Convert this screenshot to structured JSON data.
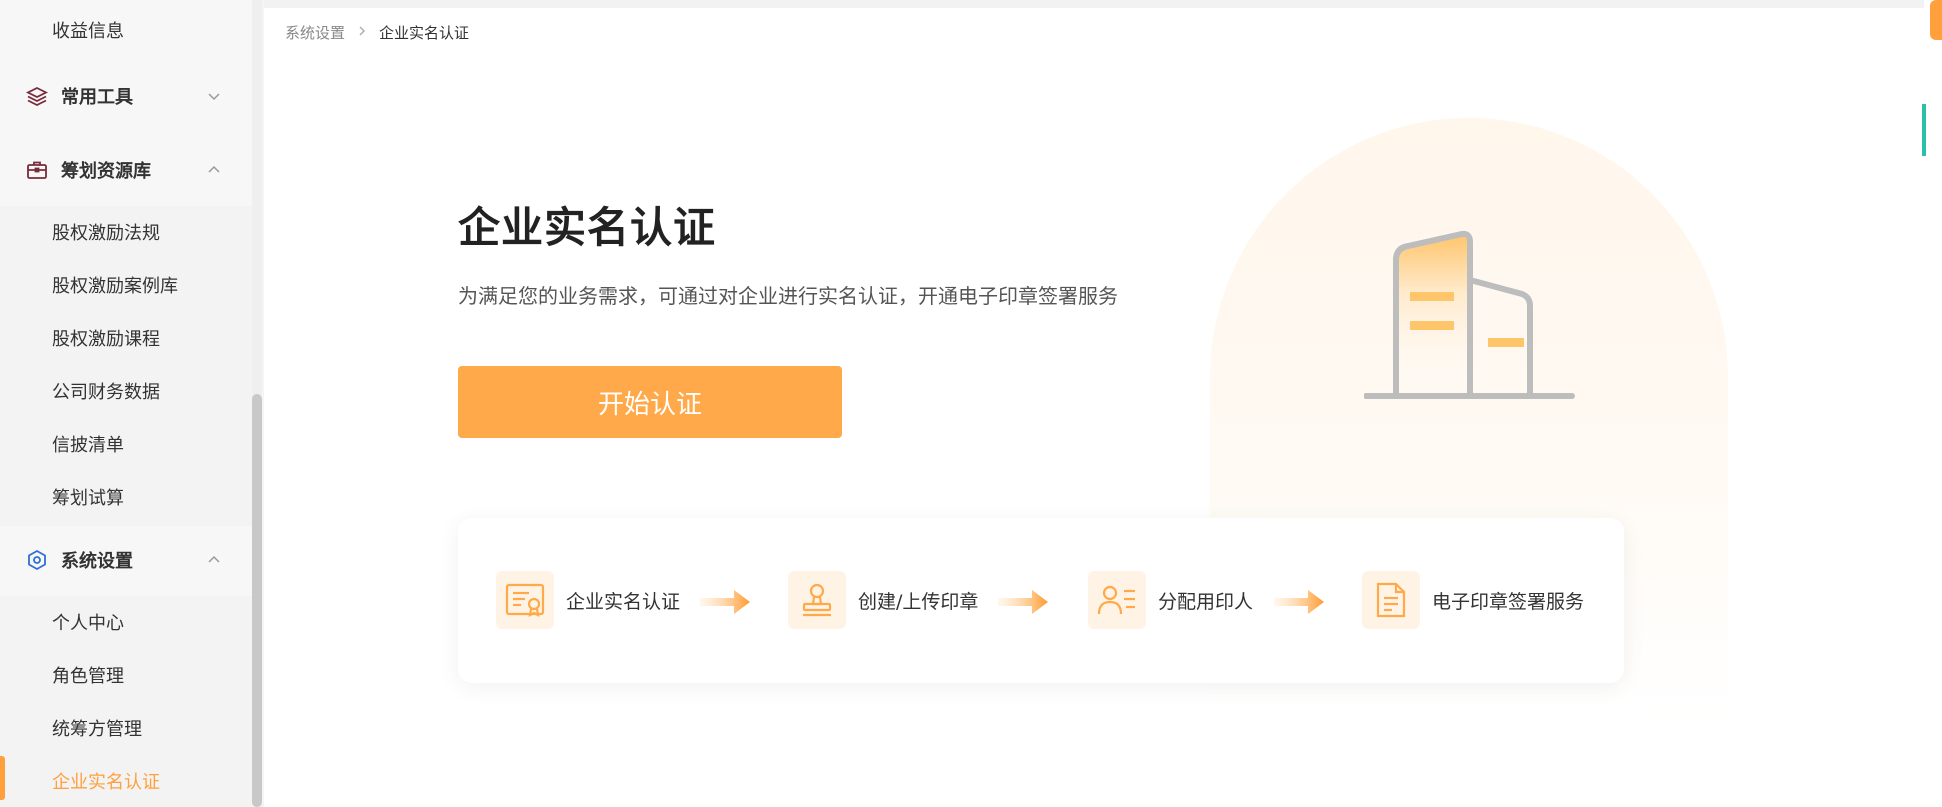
{
  "sidebar": {
    "items": [
      {
        "label": "收益信息"
      },
      {
        "label": "常用工具",
        "icon": "layers-icon"
      },
      {
        "label": "筹划资源库",
        "icon": "briefcase-icon"
      },
      {
        "label": "股权激励法规"
      },
      {
        "label": "股权激励案例库"
      },
      {
        "label": "股权激励课程"
      },
      {
        "label": "公司财务数据"
      },
      {
        "label": "信披清单"
      },
      {
        "label": "筹划试算"
      },
      {
        "label": "系统设置",
        "icon": "hexagon-gear-icon"
      },
      {
        "label": "个人中心"
      },
      {
        "label": "角色管理"
      },
      {
        "label": "统筹方管理"
      },
      {
        "label": "企业实名认证"
      }
    ]
  },
  "breadcrumb": {
    "parent": "系统设置",
    "current": "企业实名认证"
  },
  "hero": {
    "title": "企业实名认证",
    "description": "为满足您的业务需求，可通过对企业进行实名认证，开通电子印章签署服务",
    "button": "开始认证"
  },
  "steps": [
    {
      "label": "企业实名认证",
      "icon": "certificate-icon"
    },
    {
      "label": "创建/上传印章",
      "icon": "stamp-icon"
    },
    {
      "label": "分配用印人",
      "icon": "user-list-icon"
    },
    {
      "label": "电子印章签署服务",
      "icon": "document-icon"
    }
  ],
  "colors": {
    "accent": "#ffa03d",
    "button": "#ffa94a",
    "teal": "#2bc0a8"
  }
}
